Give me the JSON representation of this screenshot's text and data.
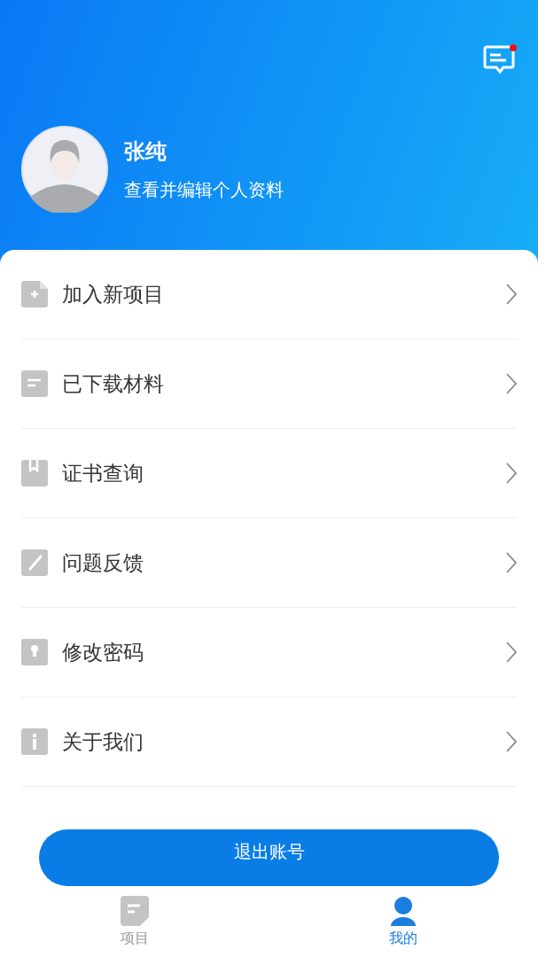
{
  "header": {
    "messages_unread": true,
    "name": "张纯",
    "subtitle": "查看并编辑个人资料"
  },
  "menu": [
    {
      "kind": "add",
      "label": "加入新项目"
    },
    {
      "kind": "doc",
      "label": "已下载材料"
    },
    {
      "kind": "bookmark",
      "label": "证书查询"
    },
    {
      "kind": "edit",
      "label": "问题反馈"
    },
    {
      "kind": "lock",
      "label": "修改密码"
    },
    {
      "kind": "info",
      "label": "关于我们"
    }
  ],
  "logout_button": "退出账号",
  "tabs": [
    {
      "kind": "project",
      "label": "项目",
      "selected": false
    },
    {
      "kind": "me",
      "label": "我的",
      "selected": true
    }
  ]
}
